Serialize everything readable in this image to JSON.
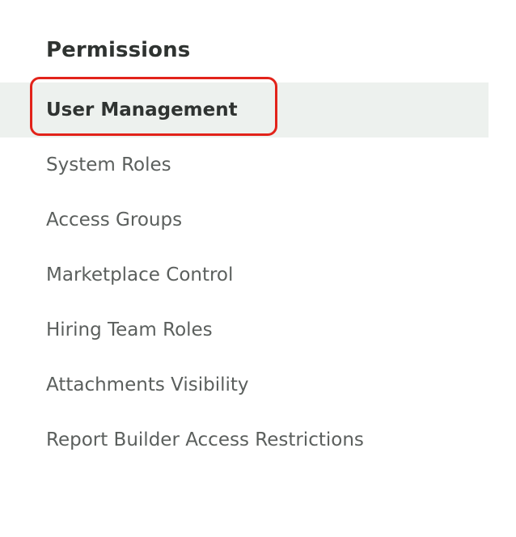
{
  "permissions": {
    "title": "Permissions",
    "items": [
      {
        "label": "User Management",
        "active": true
      },
      {
        "label": "System Roles",
        "active": false
      },
      {
        "label": "Access Groups",
        "active": false
      },
      {
        "label": "Marketplace Control",
        "active": false
      },
      {
        "label": "Hiring Team Roles",
        "active": false
      },
      {
        "label": "Attachments Visibility",
        "active": false
      },
      {
        "label": "Report Builder Access Restrictions",
        "active": false
      }
    ]
  },
  "colors": {
    "active_background": "#edf1ee",
    "highlight_ring": "#e2231a",
    "title_text": "#2f3331",
    "item_text": "#5b5f5d"
  }
}
